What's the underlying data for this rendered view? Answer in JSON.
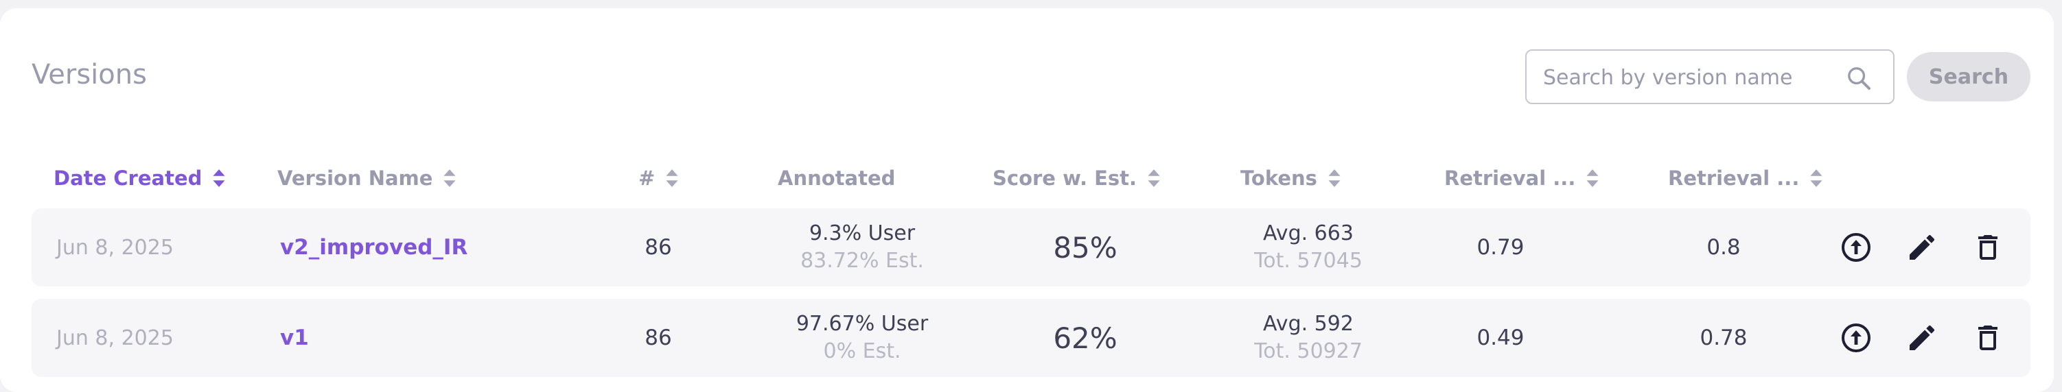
{
  "header": {
    "title": "Versions",
    "search_placeholder": "Search by version name",
    "search_value": "",
    "search_button": "Search"
  },
  "columns": [
    {
      "label": "Date Created",
      "sortable": true,
      "active": true
    },
    {
      "label": "Version Name",
      "sortable": true
    },
    {
      "label": "#",
      "sortable": true
    },
    {
      "label": "Annotated",
      "sortable": false
    },
    {
      "label": "Score w. Est.",
      "sortable": true
    },
    {
      "label": "Tokens",
      "sortable": true
    },
    {
      "label": "Retrieval ...",
      "sortable": true
    },
    {
      "label": "Retrieval ...",
      "sortable": true
    }
  ],
  "rows": [
    {
      "date": "Jun 8, 2025",
      "name": "v2_improved_IR",
      "count": "86",
      "annotated_user": "9.3% User",
      "annotated_est": "83.72% Est.",
      "score": "85%",
      "tokens_avg": "Avg. 663",
      "tokens_tot": "Tot. 57045",
      "retrieval_1": "0.79",
      "retrieval_2": "0.8"
    },
    {
      "date": "Jun 8, 2025",
      "name": "v1",
      "count": "86",
      "annotated_user": "97.67% User",
      "annotated_est": "0% Est.",
      "score": "62%",
      "tokens_avg": "Avg. 592",
      "tokens_tot": "Tot. 50927",
      "retrieval_1": "0.49",
      "retrieval_2": "0.78"
    }
  ],
  "colors": {
    "accent": "#7f56d9",
    "muted_text": "#9a9aae",
    "row_bg": "#f6f6f9",
    "icon": "#1f1f33"
  },
  "icons": {
    "search": "search-icon",
    "sort": "sort-icon",
    "upload": "upload-circle-icon",
    "edit": "pencil-icon",
    "delete": "trash-icon"
  }
}
